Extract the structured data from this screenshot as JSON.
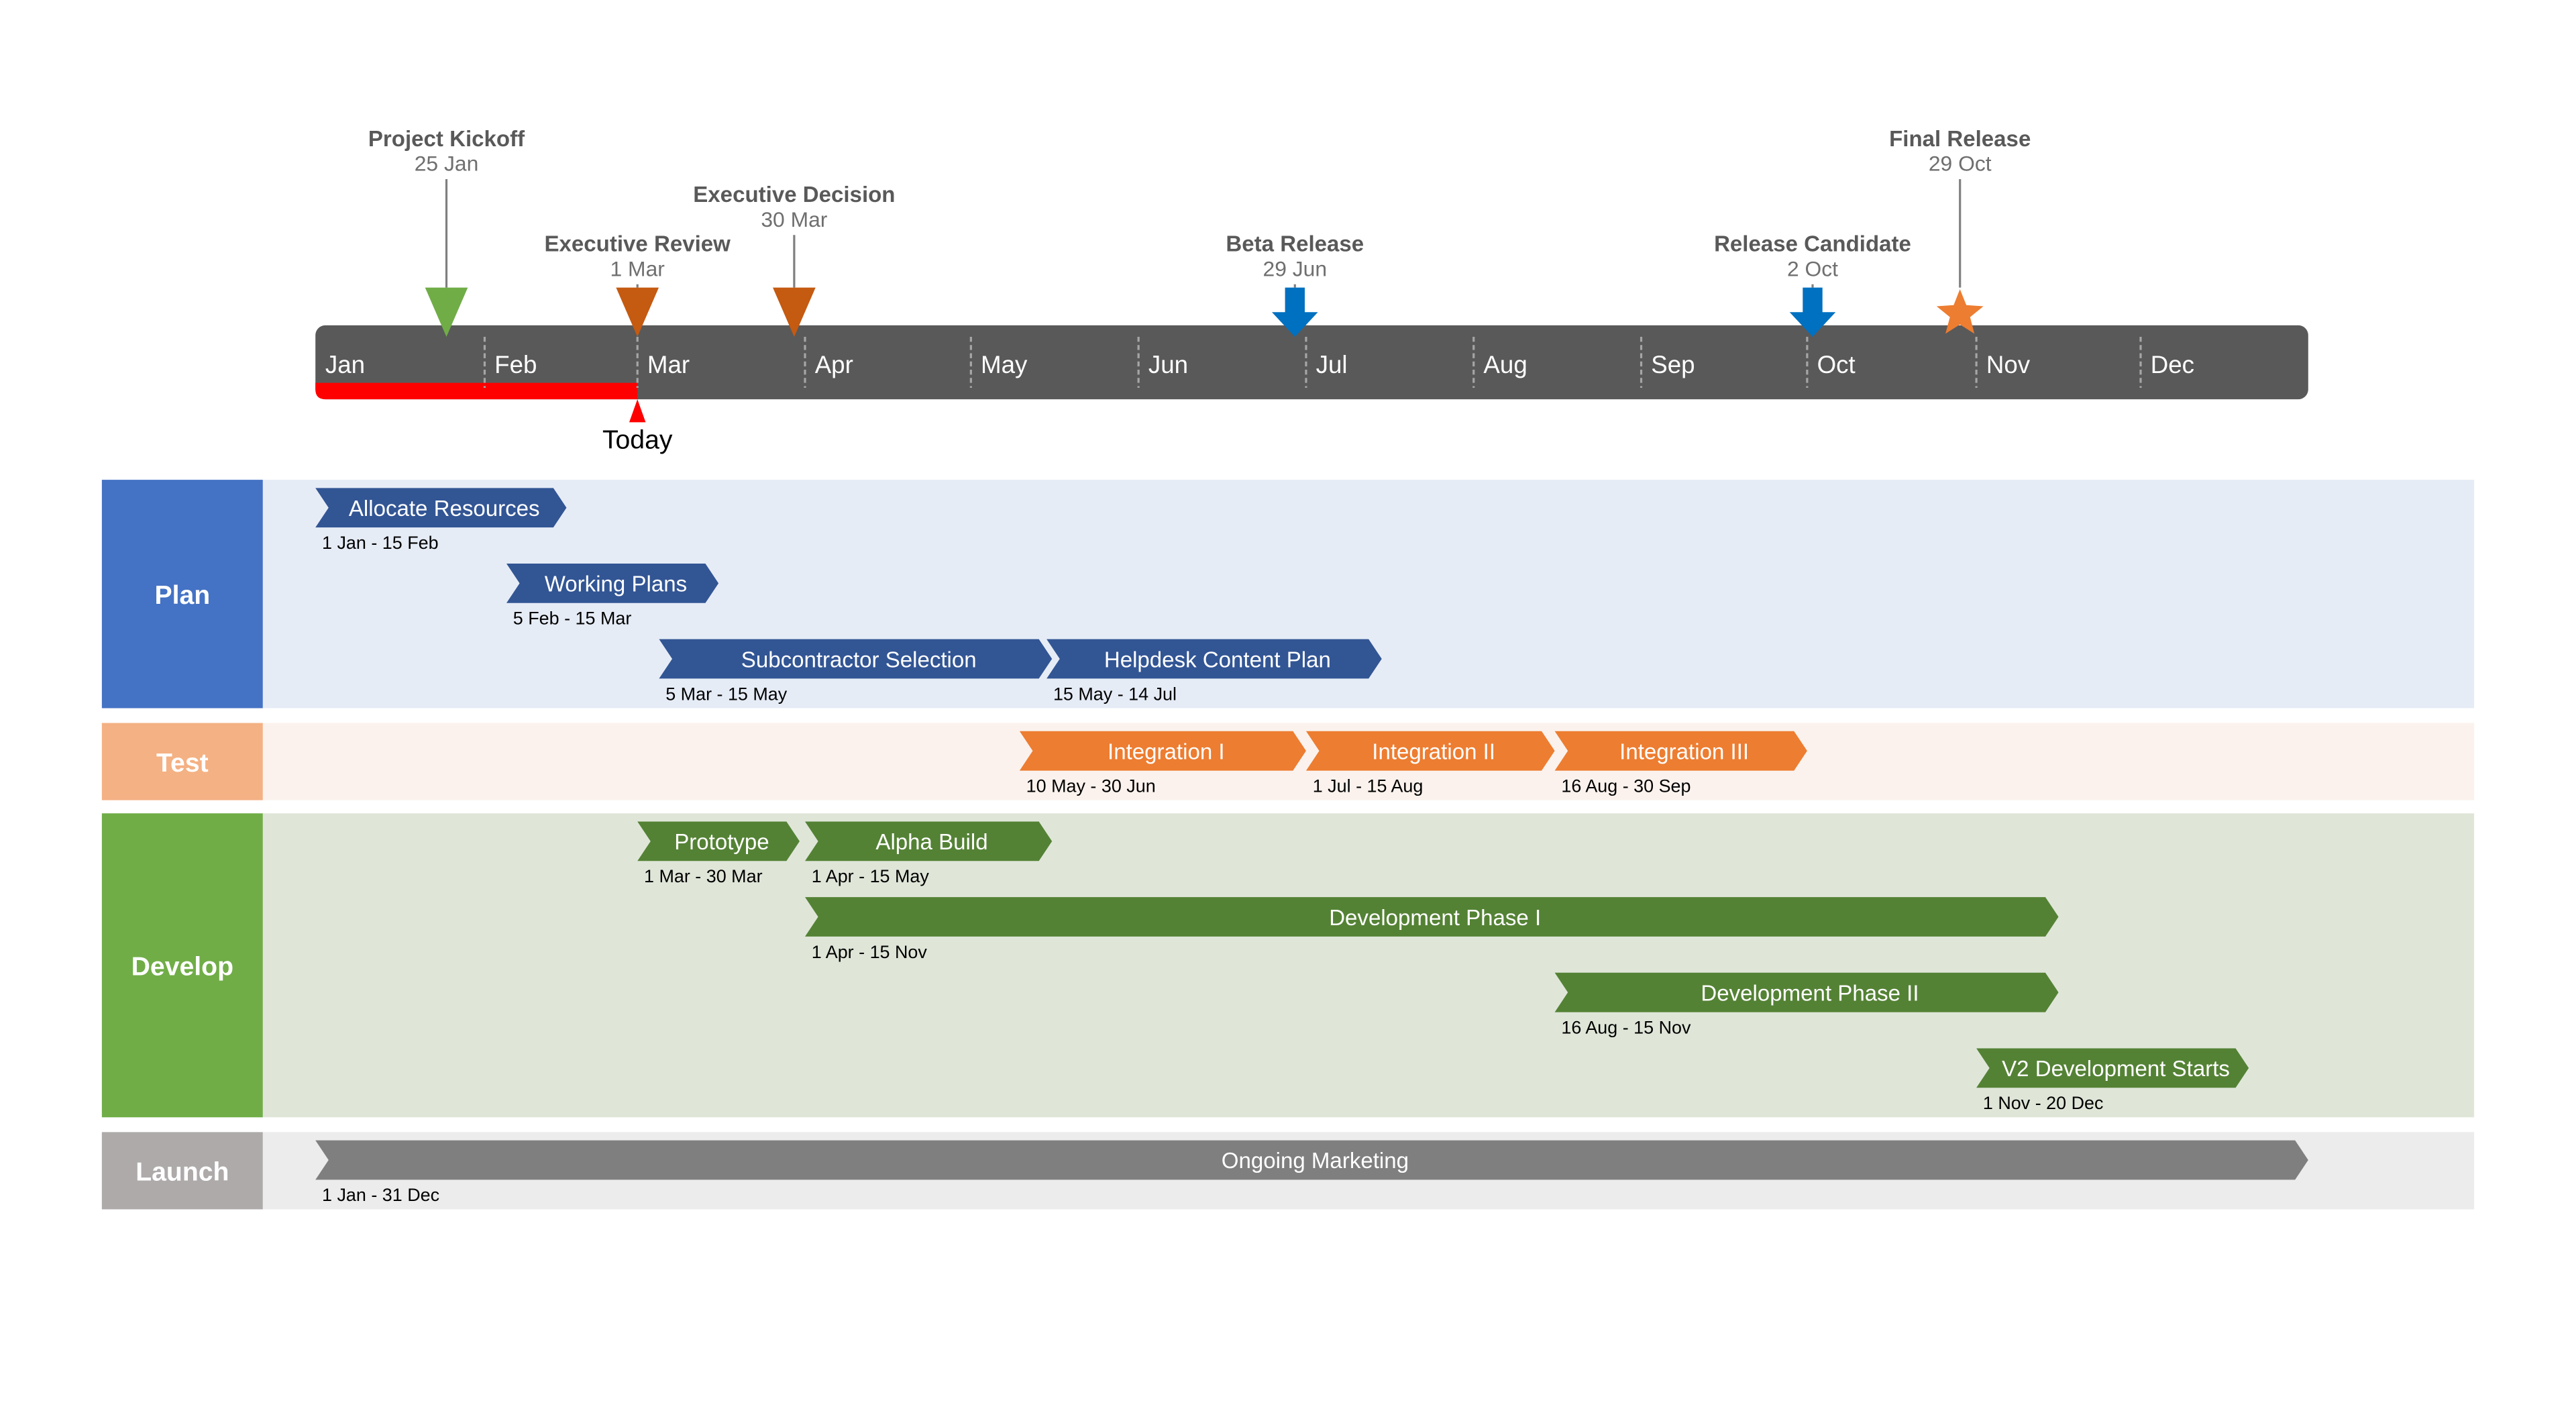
{
  "chart_data": {
    "type": "gantt",
    "title": "",
    "months": [
      "Jan",
      "Feb",
      "Mar",
      "Apr",
      "May",
      "Jun",
      "Jul",
      "Aug",
      "Sep",
      "Oct",
      "Nov",
      "Dec"
    ],
    "today": {
      "label": "Today",
      "date": "2025-02-28"
    },
    "milestones": [
      {
        "title": "Project Kickoff",
        "date_label": "25 Jan",
        "date": "2025-01-25",
        "shape": "triangle",
        "color": "#70ad47",
        "level": 0
      },
      {
        "title": "Executive Review",
        "date_label": "1 Mar",
        "date": "2025-03-01",
        "shape": "triangle",
        "color": "#c55a11",
        "level": 2
      },
      {
        "title": "Executive Decision",
        "date_label": "30 Mar",
        "date": "2025-03-30",
        "shape": "triangle",
        "color": "#c55a11",
        "level": 1
      },
      {
        "title": "Beta Release",
        "date_label": "29 Jun",
        "date": "2025-06-29",
        "shape": "arrow",
        "color": "#0070c0",
        "level": 2
      },
      {
        "title": "Release Candidate",
        "date_label": "2 Oct",
        "date": "2025-10-02",
        "shape": "arrow",
        "color": "#0070c0",
        "level": 2
      },
      {
        "title": "Final Release",
        "date_label": "29 Oct",
        "date": "2025-10-29",
        "shape": "star",
        "color": "#ed7d31",
        "level": 0
      }
    ],
    "swimlanes": [
      {
        "name": "Plan",
        "label_color": "#4472c4",
        "bg_color": "#e6ecf6",
        "bar_color": "#325594",
        "rows": 3,
        "tasks": [
          {
            "label": "Allocate Resources",
            "date_label": "1 Jan - 15 Feb",
            "start": "2025-01-01",
            "end": "2025-02-15",
            "row": 0
          },
          {
            "label": "Working Plans",
            "date_label": "5 Feb - 15 Mar",
            "start": "2025-02-05",
            "end": "2025-03-15",
            "row": 1
          },
          {
            "label": "Subcontractor Selection",
            "date_label": "5 Mar - 15 May",
            "start": "2025-03-05",
            "end": "2025-05-15",
            "row": 2
          },
          {
            "label": "Helpdesk Content Plan",
            "date_label": "15 May - 14 Jul",
            "start": "2025-05-15",
            "end": "2025-07-14",
            "row": 2
          }
        ]
      },
      {
        "name": "Test",
        "label_color": "#f4b183",
        "bg_color": "#fbf2ed",
        "bar_color": "#ed7d31",
        "rows": 1,
        "tasks": [
          {
            "label": "Integration I",
            "date_label": "10 May - 30 Jun",
            "start": "2025-05-10",
            "end": "2025-06-30",
            "row": 0
          },
          {
            "label": "Integration II",
            "date_label": "1 Jul - 15 Aug",
            "start": "2025-07-01",
            "end": "2025-08-15",
            "row": 0
          },
          {
            "label": "Integration III",
            "date_label": "16 Aug - 30 Sep",
            "start": "2025-08-16",
            "end": "2025-09-30",
            "row": 0
          }
        ]
      },
      {
        "name": "Develop",
        "label_color": "#70ad47",
        "bg_color": "#dfe6d8",
        "bar_color": "#548235",
        "rows": 4,
        "tasks": [
          {
            "label": "Prototype",
            "date_label": "1 Mar - 30 Mar",
            "start": "2025-03-01",
            "end": "2025-03-30",
            "row": 0
          },
          {
            "label": "Alpha Build",
            "date_label": "1 Apr - 15 May",
            "start": "2025-04-01",
            "end": "2025-05-15",
            "row": 0
          },
          {
            "label": "Development Phase I",
            "date_label": "1 Apr - 15 Nov",
            "start": "2025-04-01",
            "end": "2025-11-15",
            "row": 1
          },
          {
            "label": "Development Phase II",
            "date_label": "16 Aug - 15 Nov",
            "start": "2025-08-16",
            "end": "2025-11-15",
            "row": 2
          },
          {
            "label": "V2 Development Starts",
            "date_label": "1 Nov - 20 Dec",
            "start": "2025-11-01",
            "end": "2025-12-20",
            "row": 3
          }
        ]
      },
      {
        "name": "Launch",
        "label_color": "#aeaaaa",
        "bg_color": "#ececec",
        "bar_color": "#7f7f7f",
        "rows": 1,
        "tasks": [
          {
            "label": "Ongoing Marketing",
            "date_label": "1 Jan - 31 Dec",
            "start": "2025-01-01",
            "end": "2025-12-31",
            "row": 0
          }
        ]
      }
    ]
  },
  "colors": {
    "timeline_bar": "#595959",
    "today_progress": "#ff0000",
    "month_divider": "#a6a6a6",
    "milestone_stem": "#7f7f7f"
  }
}
